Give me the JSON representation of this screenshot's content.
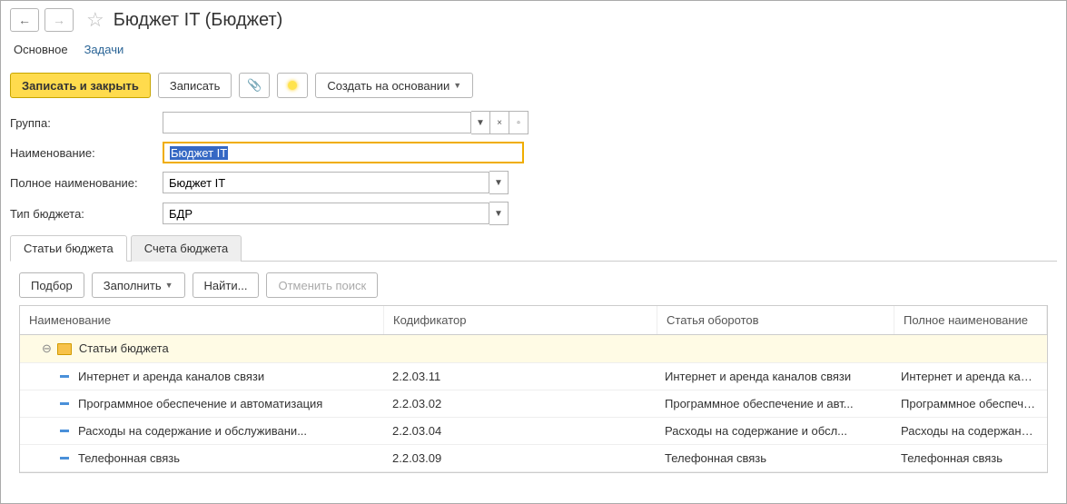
{
  "header": {
    "title": "Бюджет IT (Бюджет)"
  },
  "main_tabs": {
    "active": "Основное",
    "other": "Задачи"
  },
  "toolbar": {
    "save_close": "Записать и закрыть",
    "save": "Записать",
    "create_based": "Создать на основании"
  },
  "form": {
    "group_label": "Группа:",
    "group_value": "",
    "name_label": "Наименование:",
    "name_value": "Бюджет IT",
    "fullname_label": "Полное наименование:",
    "fullname_value": "Бюджет IT",
    "type_label": "Тип бюджета:",
    "type_value": "БДР"
  },
  "subtabs": {
    "items": "Статьи бюджета",
    "accounts": "Счета бюджета"
  },
  "subtoolbar": {
    "pick": "Подбор",
    "fill": "Заполнить",
    "find": "Найти...",
    "cancel_find": "Отменить поиск"
  },
  "grid": {
    "headers": {
      "name": "Наименование",
      "code": "Кодификатор",
      "turnover": "Статья оборотов",
      "fullname": "Полное наименование"
    },
    "root": "Статьи бюджета",
    "rows": [
      {
        "name": "Интернет и аренда каналов связи",
        "code": "2.2.03.11",
        "turnover": "Интернет и аренда каналов связи",
        "fullname": "Интернет и аренда каналов связи"
      },
      {
        "name": "Программное обеспечение и автоматизация",
        "code": "2.2.03.02",
        "turnover": "Программное обеспечение и авт...",
        "fullname": "Программное обеспечение и авт..."
      },
      {
        "name": "Расходы на содержание и обслуживани...",
        "code": "2.2.03.04",
        "turnover": "Расходы на содержание и обсл...",
        "fullname": "Расходы на содержание и обсл..."
      },
      {
        "name": "Телефонная связь",
        "code": "2.2.03.09",
        "turnover": "Телефонная связь",
        "fullname": "Телефонная связь"
      }
    ]
  }
}
